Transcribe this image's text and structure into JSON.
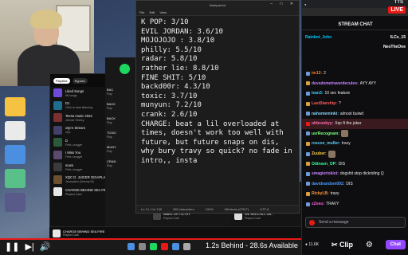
{
  "notepad": {
    "window_title": "Notepad.txt",
    "menu": [
      "File",
      "Edit",
      "View"
    ],
    "lines": [
      "K POP: 3/10",
      "EVIL JORDAN: 3.6/10",
      "MOJOJOJO : 3.8/10",
      "philly: 5.5/10",
      "radar: 5.8/10",
      "rather lie: 8.8/10",
      "FINE SHIT: 5/10",
      "backd00r: 4.3/10",
      "toxic: 3.7/10",
      "munyun: 7.2/10",
      "crank: 2.6/10",
      "CHARGE: beat a lil overloaded at times, doesn't work too well with future, but future snaps on dis, why bury travy so quick? no fade in intro,, insta"
    ],
    "status": {
      "position": "Ln 14, Col 139",
      "chars": "355 characters",
      "zoom": "100%",
      "line_ending": "Windows (CRLF)",
      "encoding": "UTF-8"
    }
  },
  "spotify": {
    "tabs": [
      "Playlists",
      "Bypass"
    ],
    "library": [
      {
        "title": "Liked Songs",
        "sub": "98 songs",
        "color": "#6d4bd8"
      },
      {
        "title": "DJ",
        "sub": "Click to start listening",
        "color": "#1e6f8e"
      },
      {
        "title": "Teesa music 2024",
        "sub": "Jimmie Shirley",
        "color": "#7a3030"
      },
      {
        "title": "xQc's Stream",
        "sub": "xQc",
        "color": "#40406a"
      },
      {
        "title": "D",
        "sub": "Félix Lengyel",
        "color": "#2a5a3a"
      },
      {
        "title": "I Miss You",
        "sub": "Félix Lengyel",
        "color": "#5a4a70"
      },
      {
        "title": "scars",
        "sub": "Félix Lengyel",
        "color": "#3a3a3a"
      },
      {
        "title": "XQC D. JUICER GIGAPLAY...",
        "sub": "Jerusalem (Jeremy M)",
        "color": "#6a5030"
      },
      {
        "title": "CHARGE BEHIND SEA FIRE",
        "sub": "Playboi Carti",
        "color": "#e6e6e6"
      }
    ],
    "main_rows": [
      {
        "title": "BAC",
        "sub": "Play"
      },
      {
        "title": "BACK",
        "sub": "Play"
      },
      {
        "title": "BACK",
        "sub": "Play"
      },
      {
        "title": "TOXIC",
        "sub": "Play"
      },
      {
        "title": "MUNY",
        "sub": "Play"
      },
      {
        "title": "CRAN",
        "sub": "Play"
      }
    ],
    "mid_rows": [
      {
        "title": "I SEEEEE YOU BABY...",
        "sub": "Playboi Carti"
      },
      {
        "title": "WAKE UP F1LTHY",
        "sub": "Playboi Carti"
      }
    ],
    "right_rows": [
      {
        "title": "COCAINE NOSE",
        "sub": "Playboi Carti"
      },
      {
        "title": "WE NEED ALL DA...",
        "sub": "Playboi Carti"
      }
    ],
    "now_playing": {
      "title": "CHARGE BEHIND SEA FIRE",
      "artist": "Playboi Carti"
    }
  },
  "player": {
    "behind_text": "1.2s Behind - 28.6s Available",
    "progress": 1.0
  },
  "stream": {
    "tts_label": "TTS",
    "live_label": "LIVE",
    "chat_header": "STREAM CHAT",
    "gifts": [
      {
        "left": "Rainbot_John",
        "left_color": "#00c8ff",
        "right": "ILCs_15",
        "right_color": "#ffffff"
      },
      {
        "left": "",
        "left_color": "#ffffff",
        "right": "NeoTheOne",
        "right_color": "#ffffff"
      }
    ],
    "messages": [
      {
        "user": "im12:",
        "color": "#ff7b1c",
        "text": "2",
        "badge": "#6b9bd8"
      },
      {
        "user": "devsdemetraverdecules:",
        "color": "#c783ff",
        "text": "AYY AYY",
        "badge": "#d8a23b"
      },
      {
        "user": "lean3:",
        "color": "#3cd0ff",
        "text": "10 sec feature",
        "badge": "#6b9bd8"
      },
      {
        "user": "LastStarship:",
        "color": "#ff5c5c",
        "text": "?",
        "badge": "#d8a23b"
      },
      {
        "user": "nahomeminki:",
        "color": "#8ad4ff",
        "text": "almost buiwd",
        "badge": "#6b9bd8"
      },
      {
        "user": "ohbrookyy:",
        "color": "#ff6fb4",
        "text": "Xqc ft the joker",
        "badge": "#e91916",
        "highlight": true
      },
      {
        "user": "usrRecognam:",
        "color": "#7cff7c",
        "text": "",
        "badge": "#6b9bd8"
      },
      {
        "user": "roscoe_muller:",
        "color": "#5ad3ff",
        "text": "travy",
        "badge": "#d8a23b"
      },
      {
        "user": "Zuuber:",
        "color": "#ffd24a",
        "text": "",
        "badge": "#6b9bd8"
      },
      {
        "user": "Odinsen_OP:",
        "color": "#3cff9e",
        "text": "DIS",
        "badge": "#d8a23b"
      },
      {
        "user": "smagieriokist:",
        "color": "#c783ff",
        "text": "dogshit stop dickriding Q",
        "badge": "#6b9bd8"
      },
      {
        "user": "davidrandom092:",
        "color": "#4a9dff",
        "text": "DIS",
        "badge": "#6b9bd8"
      },
      {
        "user": "RickyLB:",
        "color": "#ff9a3c",
        "text": "travy",
        "badge": "#d8a23b"
      },
      {
        "user": "zZoeu:",
        "color": "#ff5ce1",
        "text": "TRAVY",
        "badge": "#6b9bd8"
      }
    ],
    "input_placeholder": "Send a message",
    "viewers": "11.6K",
    "clip_label": "Clip",
    "chat_button": "Chat"
  }
}
